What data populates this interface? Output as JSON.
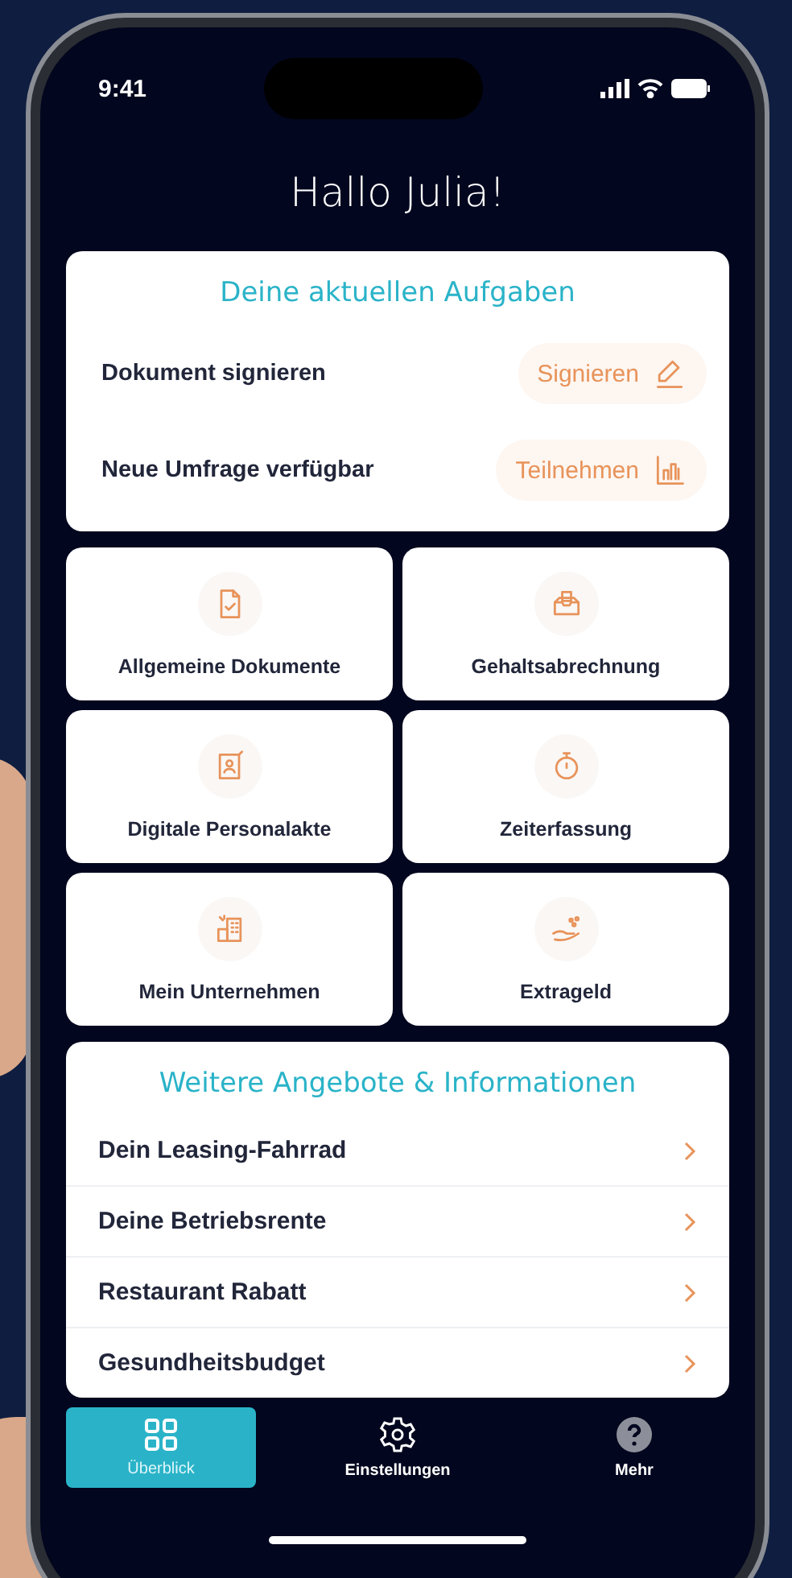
{
  "status_bar": {
    "time": "9:41"
  },
  "greeting": "Hallo Julia!",
  "tasks": {
    "title": "Deine aktuellen Aufgaben",
    "items": [
      {
        "label": "Dokument signieren",
        "action": "Signieren",
        "kind": "sign"
      },
      {
        "label": "Neue Umfrage verfügbar",
        "action": "Teilnehmen",
        "kind": "survey"
      }
    ]
  },
  "tiles": [
    {
      "label": "Allgemeine Dokumente",
      "kind": "document"
    },
    {
      "label": "Gehaltsabrechnung",
      "kind": "payslip"
    },
    {
      "label": "Digitale Personalakte",
      "kind": "file"
    },
    {
      "label": "Zeiterfassung",
      "kind": "timer"
    },
    {
      "label": "Mein Unternehmen",
      "kind": "company"
    },
    {
      "label": "Extrageld",
      "kind": "money"
    }
  ],
  "offers": {
    "title": "Weitere Angebote & Informationen",
    "items": [
      {
        "label": "Dein Leasing-Fahrrad"
      },
      {
        "label": "Deine Betriebsrente"
      },
      {
        "label": "Restaurant Rabatt"
      },
      {
        "label": "Gesundheitsbudget"
      }
    ]
  },
  "tab_bar": [
    {
      "label": "Überblick",
      "kind": "grid",
      "selected": true
    },
    {
      "label": "Einstellungen",
      "kind": "gear",
      "selected": false
    },
    {
      "label": "Mehr",
      "kind": "help",
      "selected": false
    }
  ]
}
